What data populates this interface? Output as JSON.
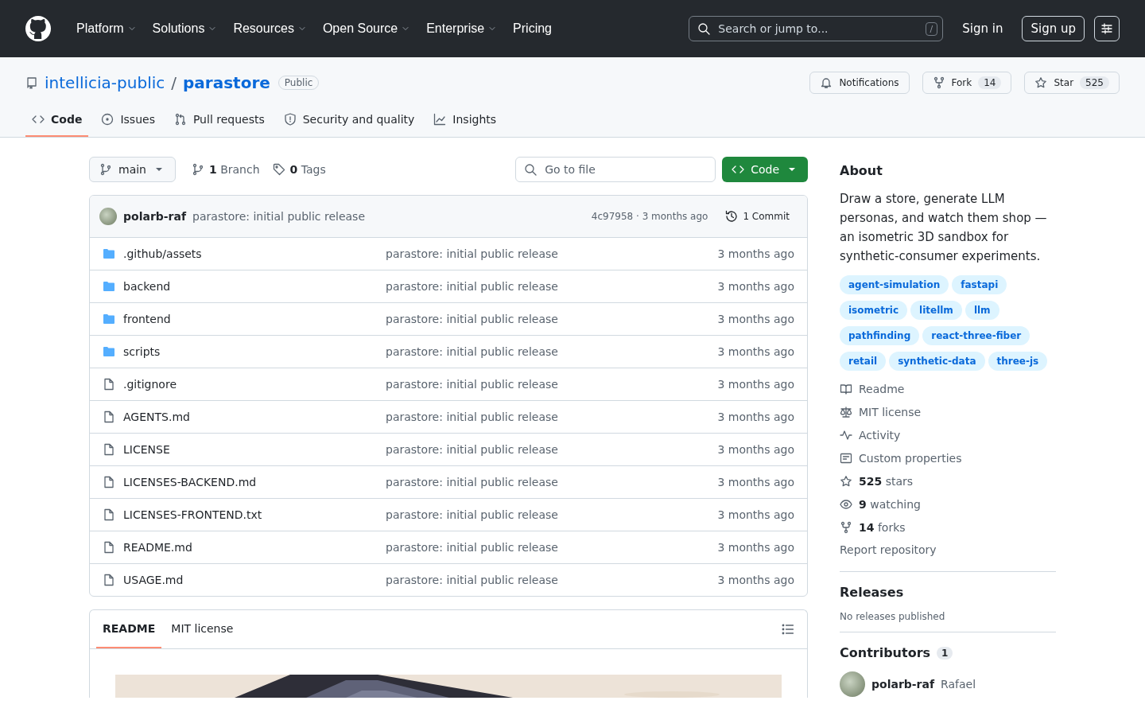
{
  "header": {
    "nav": [
      {
        "label": "Platform",
        "dropdown": true
      },
      {
        "label": "Solutions",
        "dropdown": true
      },
      {
        "label": "Resources",
        "dropdown": true
      },
      {
        "label": "Open Source",
        "dropdown": true
      },
      {
        "label": "Enterprise",
        "dropdown": true
      },
      {
        "label": "Pricing",
        "dropdown": false
      }
    ],
    "search": {
      "placeholder": "Search or jump to...",
      "shortcut": "/"
    },
    "sign_in": "Sign in",
    "sign_up": "Sign up"
  },
  "repo": {
    "owner": "intellicia-public",
    "separator": "/",
    "name": "parastore",
    "visibility": "Public",
    "notifications": "Notifications",
    "fork": {
      "label": "Fork",
      "count": "14"
    },
    "star": {
      "label": "Star",
      "count": "525"
    },
    "tabs": [
      {
        "label": "Code",
        "selected": true
      },
      {
        "label": "Issues",
        "selected": false
      },
      {
        "label": "Pull requests",
        "selected": false
      },
      {
        "label": "Security and quality",
        "selected": false
      },
      {
        "label": "Insights",
        "selected": false
      }
    ]
  },
  "files": {
    "branch": "main",
    "branches": "**1** Branch",
    "tags": "**0** Tags",
    "go_to_file": {
      "placeholder": "Go to file"
    },
    "code_button": "Code",
    "latest_commit": {
      "author": "polarb-raf",
      "message": "parastore: initial public release",
      "hash_time": "4c97958 · 3 months ago",
      "commits": "1 Commit"
    },
    "rows": [
      {
        "name": ".github/assets",
        "kind": "folder",
        "message": "parastore: initial public release",
        "time": "3 months ago"
      },
      {
        "name": "backend",
        "kind": "folder",
        "message": "parastore: initial public release",
        "time": "3 months ago"
      },
      {
        "name": "frontend",
        "kind": "folder",
        "message": "parastore: initial public release",
        "time": "3 months ago"
      },
      {
        "name": "scripts",
        "kind": "folder",
        "message": "parastore: initial public release",
        "time": "3 months ago"
      },
      {
        "name": ".gitignore",
        "kind": "file",
        "message": "parastore: initial public release",
        "time": "3 months ago"
      },
      {
        "name": "AGENTS.md",
        "kind": "file",
        "message": "parastore: initial public release",
        "time": "3 months ago"
      },
      {
        "name": "LICENSE",
        "kind": "file",
        "message": "parastore: initial public release",
        "time": "3 months ago"
      },
      {
        "name": "LICENSES-BACKEND.md",
        "kind": "file",
        "message": "parastore: initial public release",
        "time": "3 months ago"
      },
      {
        "name": "LICENSES-FRONTEND.txt",
        "kind": "file",
        "message": "parastore: initial public release",
        "time": "3 months ago"
      },
      {
        "name": "README.md",
        "kind": "file",
        "message": "parastore: initial public release",
        "time": "3 months ago"
      },
      {
        "name": "USAGE.md",
        "kind": "file",
        "message": "parastore: initial public release",
        "time": "3 months ago"
      }
    ]
  },
  "readme": {
    "tabs": [
      {
        "label": "README",
        "selected": true
      },
      {
        "label": "MIT license",
        "selected": false
      }
    ]
  },
  "about": {
    "heading": "About",
    "description": "Draw a store, generate LLM personas, and watch them shop — an isometric 3D sandbox for synthetic-consumer experiments.",
    "topics": [
      "agent-simulation",
      "fastapi",
      "isometric",
      "litellm",
      "llm",
      "pathfinding",
      "react-three-fiber",
      "retail",
      "synthetic-data",
      "three-js"
    ],
    "links": [
      "Readme",
      "MIT license",
      "Activity",
      "Custom properties",
      "**525** stars",
      "**9** watching",
      "**14** forks"
    ],
    "report": "Report repository",
    "releases": {
      "heading": "Releases",
      "note": "No releases published"
    },
    "contributors": {
      "heading": "Contributors",
      "count": "1",
      "people": [
        {
          "login": "polarb-raf",
          "name": "Rafael"
        }
      ]
    }
  }
}
